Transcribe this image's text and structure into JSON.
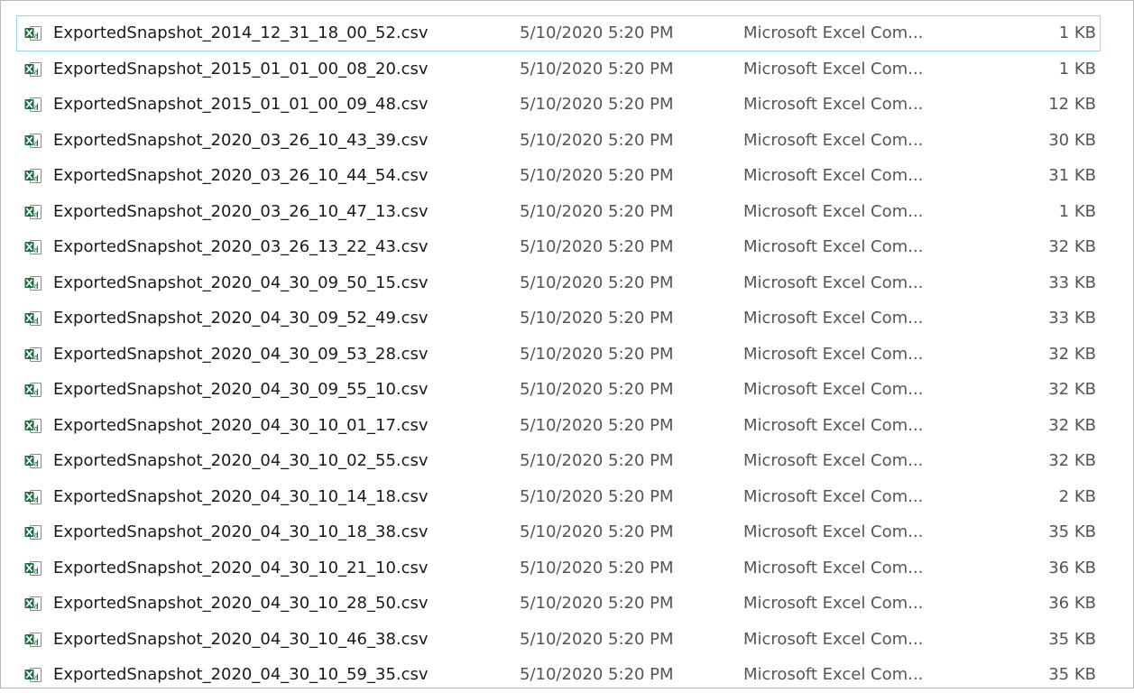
{
  "files": [
    {
      "name": "ExportedSnapshot_2014_12_31_18_00_52.csv",
      "date": "5/10/2020 5:20 PM",
      "type": "Microsoft Excel Com...",
      "size": "1 KB",
      "icon": "excel-csv-icon",
      "selected": true
    },
    {
      "name": "ExportedSnapshot_2015_01_01_00_08_20.csv",
      "date": "5/10/2020 5:20 PM",
      "type": "Microsoft Excel Com...",
      "size": "1 KB",
      "icon": "excel-csv-icon"
    },
    {
      "name": "ExportedSnapshot_2015_01_01_00_09_48.csv",
      "date": "5/10/2020 5:20 PM",
      "type": "Microsoft Excel Com...",
      "size": "12 KB",
      "icon": "excel-csv-icon"
    },
    {
      "name": "ExportedSnapshot_2020_03_26_10_43_39.csv",
      "date": "5/10/2020 5:20 PM",
      "type": "Microsoft Excel Com...",
      "size": "30 KB",
      "icon": "excel-csv-icon"
    },
    {
      "name": "ExportedSnapshot_2020_03_26_10_44_54.csv",
      "date": "5/10/2020 5:20 PM",
      "type": "Microsoft Excel Com...",
      "size": "31 KB",
      "icon": "excel-csv-icon"
    },
    {
      "name": "ExportedSnapshot_2020_03_26_10_47_13.csv",
      "date": "5/10/2020 5:20 PM",
      "type": "Microsoft Excel Com...",
      "size": "1 KB",
      "icon": "excel-csv-icon"
    },
    {
      "name": "ExportedSnapshot_2020_03_26_13_22_43.csv",
      "date": "5/10/2020 5:20 PM",
      "type": "Microsoft Excel Com...",
      "size": "32 KB",
      "icon": "excel-csv-icon"
    },
    {
      "name": "ExportedSnapshot_2020_04_30_09_50_15.csv",
      "date": "5/10/2020 5:20 PM",
      "type": "Microsoft Excel Com...",
      "size": "33 KB",
      "icon": "excel-csv-icon"
    },
    {
      "name": "ExportedSnapshot_2020_04_30_09_52_49.csv",
      "date": "5/10/2020 5:20 PM",
      "type": "Microsoft Excel Com...",
      "size": "33 KB",
      "icon": "excel-csv-icon"
    },
    {
      "name": "ExportedSnapshot_2020_04_30_09_53_28.csv",
      "date": "5/10/2020 5:20 PM",
      "type": "Microsoft Excel Com...",
      "size": "32 KB",
      "icon": "excel-csv-icon"
    },
    {
      "name": "ExportedSnapshot_2020_04_30_09_55_10.csv",
      "date": "5/10/2020 5:20 PM",
      "type": "Microsoft Excel Com...",
      "size": "32 KB",
      "icon": "excel-csv-icon"
    },
    {
      "name": "ExportedSnapshot_2020_04_30_10_01_17.csv",
      "date": "5/10/2020 5:20 PM",
      "type": "Microsoft Excel Com...",
      "size": "32 KB",
      "icon": "excel-csv-icon"
    },
    {
      "name": "ExportedSnapshot_2020_04_30_10_02_55.csv",
      "date": "5/10/2020 5:20 PM",
      "type": "Microsoft Excel Com...",
      "size": "32 KB",
      "icon": "excel-csv-icon"
    },
    {
      "name": "ExportedSnapshot_2020_04_30_10_14_18.csv",
      "date": "5/10/2020 5:20 PM",
      "type": "Microsoft Excel Com...",
      "size": "2 KB",
      "icon": "excel-csv-icon"
    },
    {
      "name": "ExportedSnapshot_2020_04_30_10_18_38.csv",
      "date": "5/10/2020 5:20 PM",
      "type": "Microsoft Excel Com...",
      "size": "35 KB",
      "icon": "excel-csv-icon"
    },
    {
      "name": "ExportedSnapshot_2020_04_30_10_21_10.csv",
      "date": "5/10/2020 5:20 PM",
      "type": "Microsoft Excel Com...",
      "size": "36 KB",
      "icon": "excel-csv-icon"
    },
    {
      "name": "ExportedSnapshot_2020_04_30_10_28_50.csv",
      "date": "5/10/2020 5:20 PM",
      "type": "Microsoft Excel Com...",
      "size": "36 KB",
      "icon": "excel-csv-icon"
    },
    {
      "name": "ExportedSnapshot_2020_04_30_10_46_38.csv",
      "date": "5/10/2020 5:20 PM",
      "type": "Microsoft Excel Com...",
      "size": "35 KB",
      "icon": "excel-csv-icon"
    },
    {
      "name": "ExportedSnapshot_2020_04_30_10_59_35.csv",
      "date": "5/10/2020 5:20 PM",
      "type": "Microsoft Excel Com...",
      "size": "35 KB",
      "icon": "excel-csv-icon"
    }
  ],
  "colors": {
    "excel_green": "#1D6F42",
    "selection_border": "#99D1FF",
    "secondary_text": "#555555"
  }
}
